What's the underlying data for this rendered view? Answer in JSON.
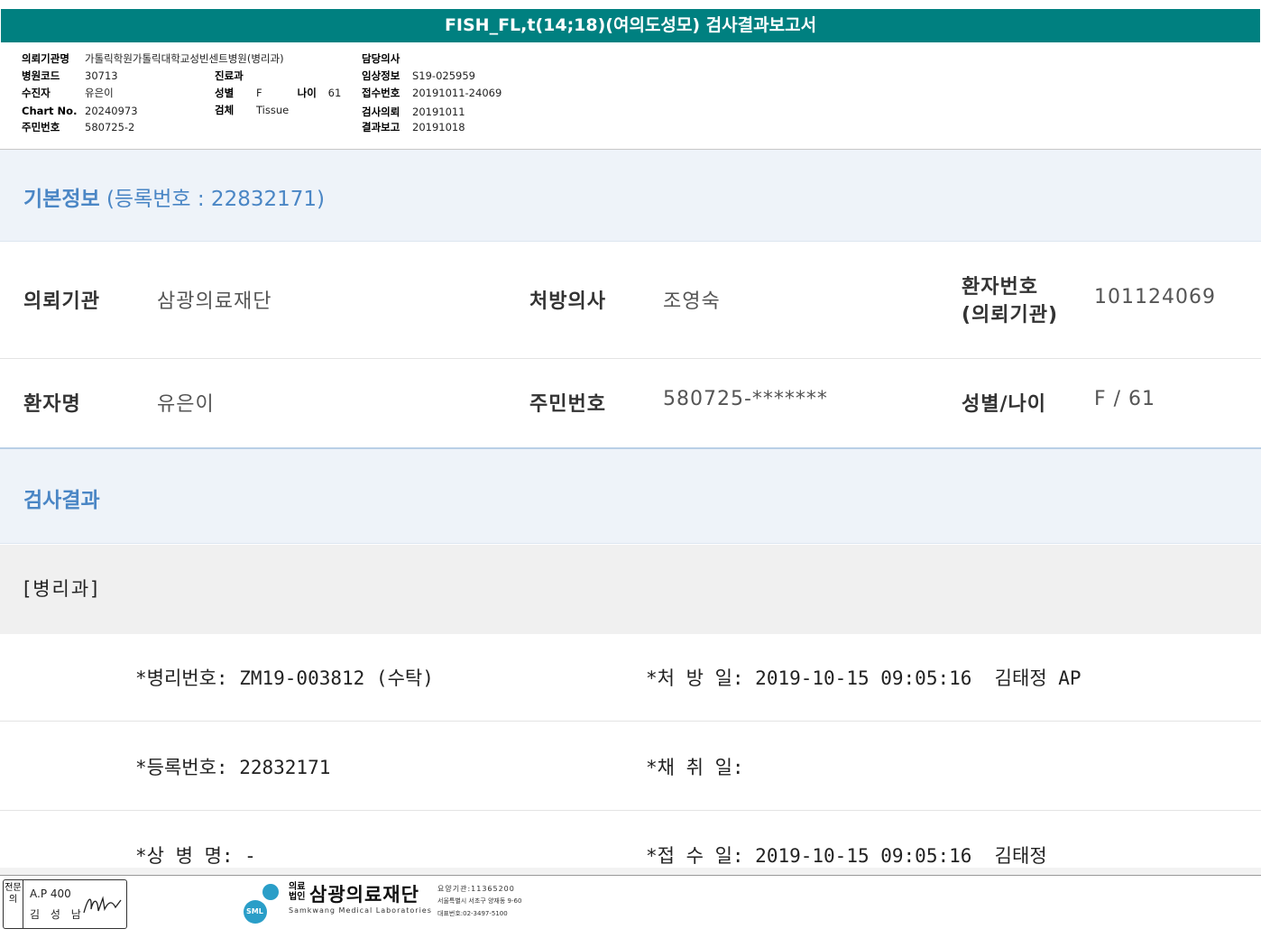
{
  "report": {
    "title": "FISH_FL,t(14;18)(여의도성모) 검사결과보고서"
  },
  "header": {
    "institution_label": "의뢰기관명",
    "institution_value": "가톨릭학원가톨릭대학교성빈센트병원(병리과)",
    "hospital_code_label": "병원코드",
    "hospital_code_value": "30713",
    "recipient_label": "수진자",
    "recipient_value": "유은이",
    "chart_label": "Chart No.",
    "chart_value": "20240973",
    "rrn_label": "주민번호",
    "rrn_value": "580725-2",
    "dept_label": "진료과",
    "dept_value": "",
    "sex_label": "성별",
    "sex_value": "F",
    "age_label": "나이",
    "age_value": "61",
    "specimen_label": "검체",
    "specimen_value": "Tissue",
    "doctor_label": "담당의사",
    "doctor_value": "",
    "clinical_label": "임상정보",
    "clinical_value": "S19-025959",
    "accession_label": "접수번호",
    "accession_value": "20191011-24069",
    "request_label": "검사의뢰",
    "request_value": "20191011",
    "report_label": "결과보고",
    "report_value": "20191018"
  },
  "basic_info": {
    "title": "기본정보",
    "reg": "(등록번호 : 22832171)",
    "ref_inst_label": "의뢰기관",
    "ref_inst_value": "삼광의료재단",
    "prescriber_label": "처방의사",
    "prescriber_value": "조영숙",
    "patient_no_label_1": "환자번호",
    "patient_no_label_2": "(의뢰기관)",
    "patient_no_value": "101124069",
    "patient_name_label": "환자명",
    "patient_name_value": "유은이",
    "rrn_label": "주민번호",
    "rrn_value": "580725-*******",
    "sex_age_label": "성별/나이",
    "sex_age_value": "F / 61"
  },
  "results": {
    "title": "검사결과",
    "dept": "[병리과]",
    "pathology_no": "*병리번호: ZM19-003812 (수탁)",
    "prescribed_date": "*처 방 일: 2019-10-15 09:05:16  김태정 AP",
    "reg_no": "*등록번호: 22832171",
    "collection_date": "*채 취 일:",
    "diagnosis": "*상 병 명: -",
    "received_date": "*접 수 일: 2019-10-15 09:05:16  김태정"
  },
  "footer": {
    "side": "전문의",
    "sig_line1": "A.P 400",
    "sig_line2": "김 성 남",
    "logo_badge": "SML",
    "legal": "의료\n법인",
    "org_name": "삼광의료재단",
    "org_en": "Samkwang Medical Laboratories",
    "code": "요양기관:11365200",
    "address": "서울특별시 서초구 양재동 9-60",
    "phone": "대표번호:02-3497-5100"
  }
}
